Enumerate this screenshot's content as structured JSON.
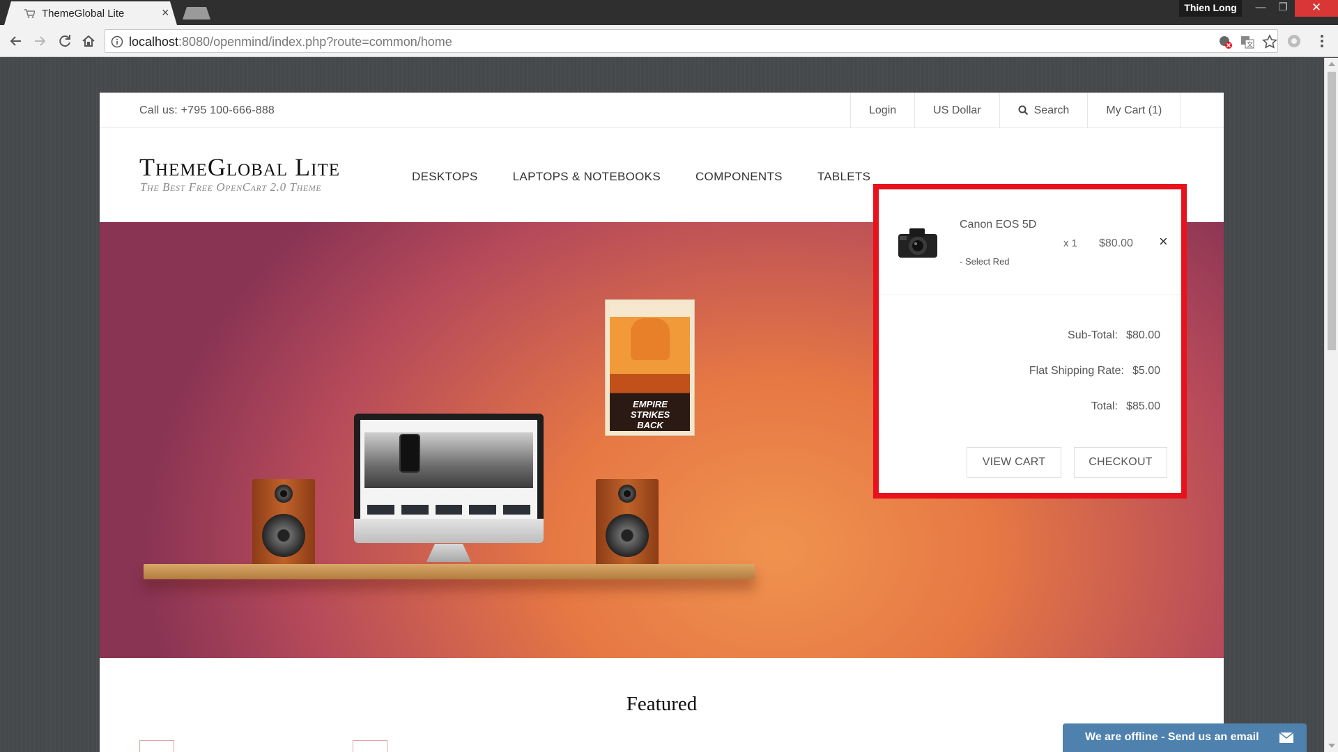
{
  "browser": {
    "tab_title": "ThemeGlobal Lite",
    "tab_close": "×",
    "profile_name": "Thien Long",
    "url_host": "localhost",
    "url_rest": ":8080/openmind/index.php?route=common/home",
    "window_minimize": "—",
    "window_maximize": "❐",
    "window_close": "✕",
    "icons": [
      "back-icon",
      "forward-icon",
      "reload-icon",
      "home-icon",
      "info-icon",
      "cookie-blocked-icon",
      "translate-icon",
      "bookmark-star-icon",
      "extension-icon",
      "menu-icon"
    ]
  },
  "site": {
    "call_us": "Call us: +795 100-666-888",
    "top_nav": {
      "login": "Login",
      "currency": "US Dollar",
      "search": "Search",
      "cart": "My Cart (1)"
    },
    "logo_title": "ThemeGlobal Lite",
    "logo_subtitle": "The Best Free OpenCart 2.0 Theme",
    "main_nav": [
      "DESKTOPS",
      "LAPTOPS & NOTEBOOKS",
      "COMPONENTS",
      "TABLETS"
    ],
    "hero": {
      "poster_text": "EMPIRE STRIKES BACK"
    },
    "featured_heading": "Featured"
  },
  "cart_dropdown": {
    "item": {
      "name": "Canon EOS 5D",
      "option": "- Select Red",
      "quantity": "x 1",
      "price": "$80.00",
      "remove": "×"
    },
    "totals": [
      {
        "label": "Sub-Total:",
        "value": "$80.00"
      },
      {
        "label": "Flat Shipping Rate:",
        "value": "$5.00"
      },
      {
        "label": "Total:",
        "value": "$85.00"
      }
    ],
    "view_cart": "VIEW CART",
    "checkout": "CHECKOUT",
    "highlight_color": "#e8121d"
  },
  "chat": {
    "label": "We are offline - Send us an email",
    "color": "#4e81ad"
  }
}
